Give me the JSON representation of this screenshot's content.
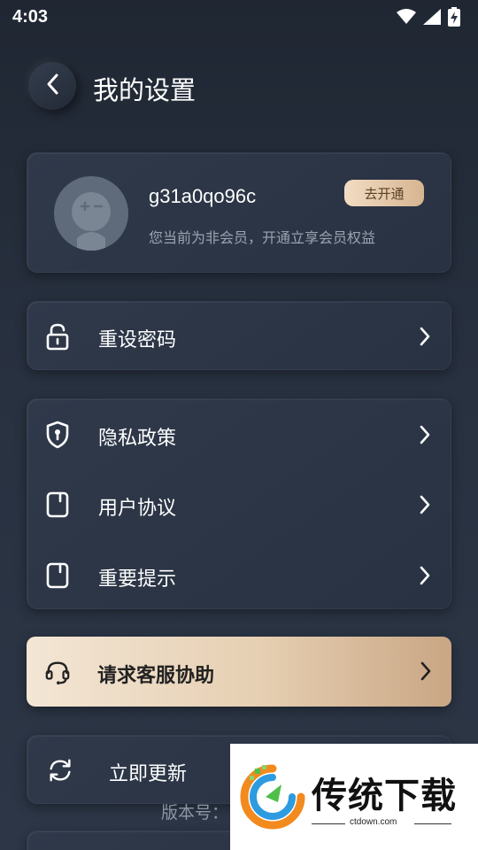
{
  "status_bar": {
    "time": "4:03",
    "icons": [
      "wifi-icon",
      "signal-icon",
      "battery-charging-icon"
    ]
  },
  "header": {
    "title": "我的设置",
    "back_icon": "chevron-left-icon"
  },
  "profile": {
    "username": "g31a0qo96c",
    "member_note": "您当前为非会员，开通立享会员权益",
    "open_button": "去开通"
  },
  "menu": {
    "reset_password": "重设密码",
    "privacy_policy": "隐私政策",
    "user_agreement": "用户协议",
    "important_notice": "重要提示",
    "customer_service": "请求客服协助",
    "update_now": "立即更新"
  },
  "version": {
    "label": "版本号："
  },
  "watermark": {
    "brand": "传统下载",
    "url": "ctdown.com"
  },
  "colors": {
    "background": "#283140",
    "card": "#2f394a",
    "accent_gold": "#d7b591",
    "muted_text": "#9aa3b0"
  }
}
